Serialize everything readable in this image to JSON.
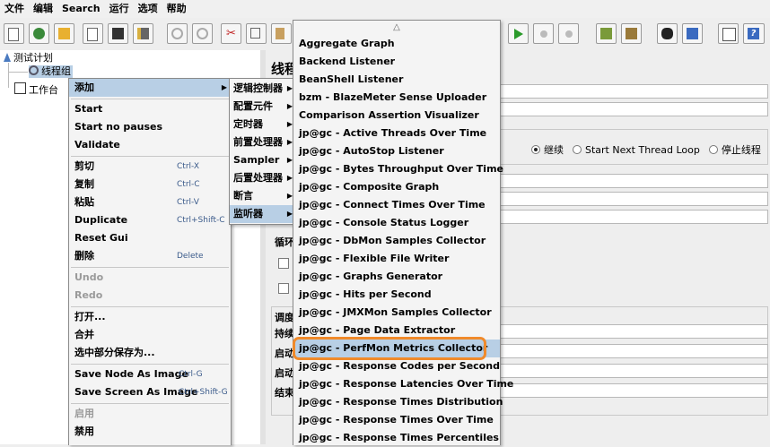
{
  "menubar": [
    "文件",
    "编辑",
    "Search",
    "运行",
    "选项",
    "帮助"
  ],
  "tree": {
    "test_plan": "测试计划",
    "thread_group": "线程组",
    "workbench": "工作台"
  },
  "panel": {
    "title": "线程",
    "radio_continue": "继续",
    "radio_next_loop": "Start Next Thread Loop",
    "radio_stop": "停止线程",
    "loop_label": "循环",
    "sched_label": "调度",
    "duration_label": "持续",
    "start_label": "启动",
    "startup_label": "启动",
    "end_label": "结束"
  },
  "context_menu": {
    "items": [
      {
        "label": "添加",
        "arrow": "▶",
        "selected": true
      },
      {
        "label": "Start"
      },
      {
        "label": "Start no pauses"
      },
      {
        "label": "Validate"
      },
      {
        "label": "剪切",
        "shortcut": "Ctrl-X"
      },
      {
        "label": "复制",
        "shortcut": "Ctrl-C"
      },
      {
        "label": "粘贴",
        "shortcut": "Ctrl-V"
      },
      {
        "label": "Duplicate",
        "shortcut": "Ctrl+Shift-C"
      },
      {
        "label": "Reset Gui"
      },
      {
        "label": "删除",
        "shortcut": "Delete"
      },
      {
        "label": "Undo",
        "disabled": true
      },
      {
        "label": "Redo",
        "disabled": true
      },
      {
        "label": "打开..."
      },
      {
        "label": "合并"
      },
      {
        "label": "选中部分保存为..."
      },
      {
        "label": "Save Node As Image",
        "shortcut": "Ctrl-G"
      },
      {
        "label": "Save Screen As Image",
        "shortcut": "Ctrl+Shift-G"
      },
      {
        "label": "启用",
        "disabled": true
      },
      {
        "label": "禁用"
      }
    ]
  },
  "add_submenu": {
    "items": [
      {
        "label": "逻辑控制器"
      },
      {
        "label": "配置元件"
      },
      {
        "label": "定时器"
      },
      {
        "label": "前置处理器"
      },
      {
        "label": "Sampler"
      },
      {
        "label": "后置处理器"
      },
      {
        "label": "断言"
      },
      {
        "label": "监听器",
        "selected": true
      }
    ]
  },
  "listener_menu": {
    "scroll_up": "△",
    "items": [
      "Aggregate Graph",
      "Backend Listener",
      "BeanShell Listener",
      "bzm - BlazeMeter Sense Uploader",
      "Comparison Assertion Visualizer",
      "jp@gc - Active Threads Over Time",
      "jp@gc - AutoStop Listener",
      "jp@gc - Bytes Throughput Over Time",
      "jp@gc - Composite Graph",
      "jp@gc - Connect Times Over Time",
      "jp@gc - Console Status Logger",
      "jp@gc - DbMon Samples Collector",
      "jp@gc - Flexible File Writer",
      "jp@gc - Graphs Generator",
      "jp@gc - Hits per Second",
      "jp@gc - JMXMon Samples Collector",
      "jp@gc - Page Data Extractor",
      "jp@gc - PerfMon Metrics Collector",
      "jp@gc - Response Codes per Second",
      "jp@gc - Response Latencies Over Time",
      "jp@gc - Response Times Distribution",
      "jp@gc - Response Times Over Time",
      "jp@gc - Response Times Percentiles"
    ],
    "highlighted_index": 17,
    "highlight_color": "#f08a2a"
  }
}
